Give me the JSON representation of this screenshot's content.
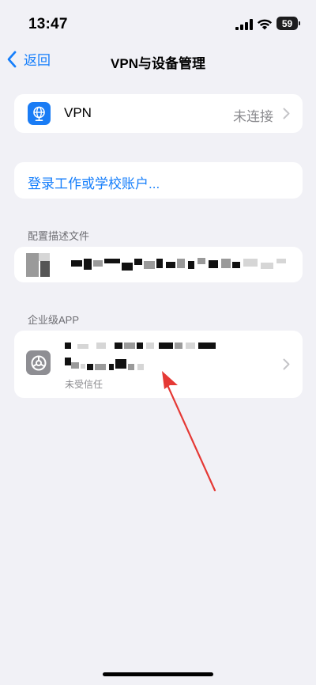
{
  "status": {
    "time": "13:47",
    "battery": "59"
  },
  "nav": {
    "back_label": "返回",
    "title": "VPN与设备管理"
  },
  "vpn": {
    "label": "VPN",
    "status": "未连接"
  },
  "login": {
    "label": "登录工作或学校账户..."
  },
  "sections": {
    "profiles": "配置描述文件",
    "enterprise": "企业级APP"
  },
  "enterprise_app": {
    "trust_status": "未受信任"
  },
  "colors": {
    "accent": "#157efb",
    "background": "#f1f1f6",
    "arrow": "#e53935",
    "vpn_icon": "#1a7cf5"
  }
}
